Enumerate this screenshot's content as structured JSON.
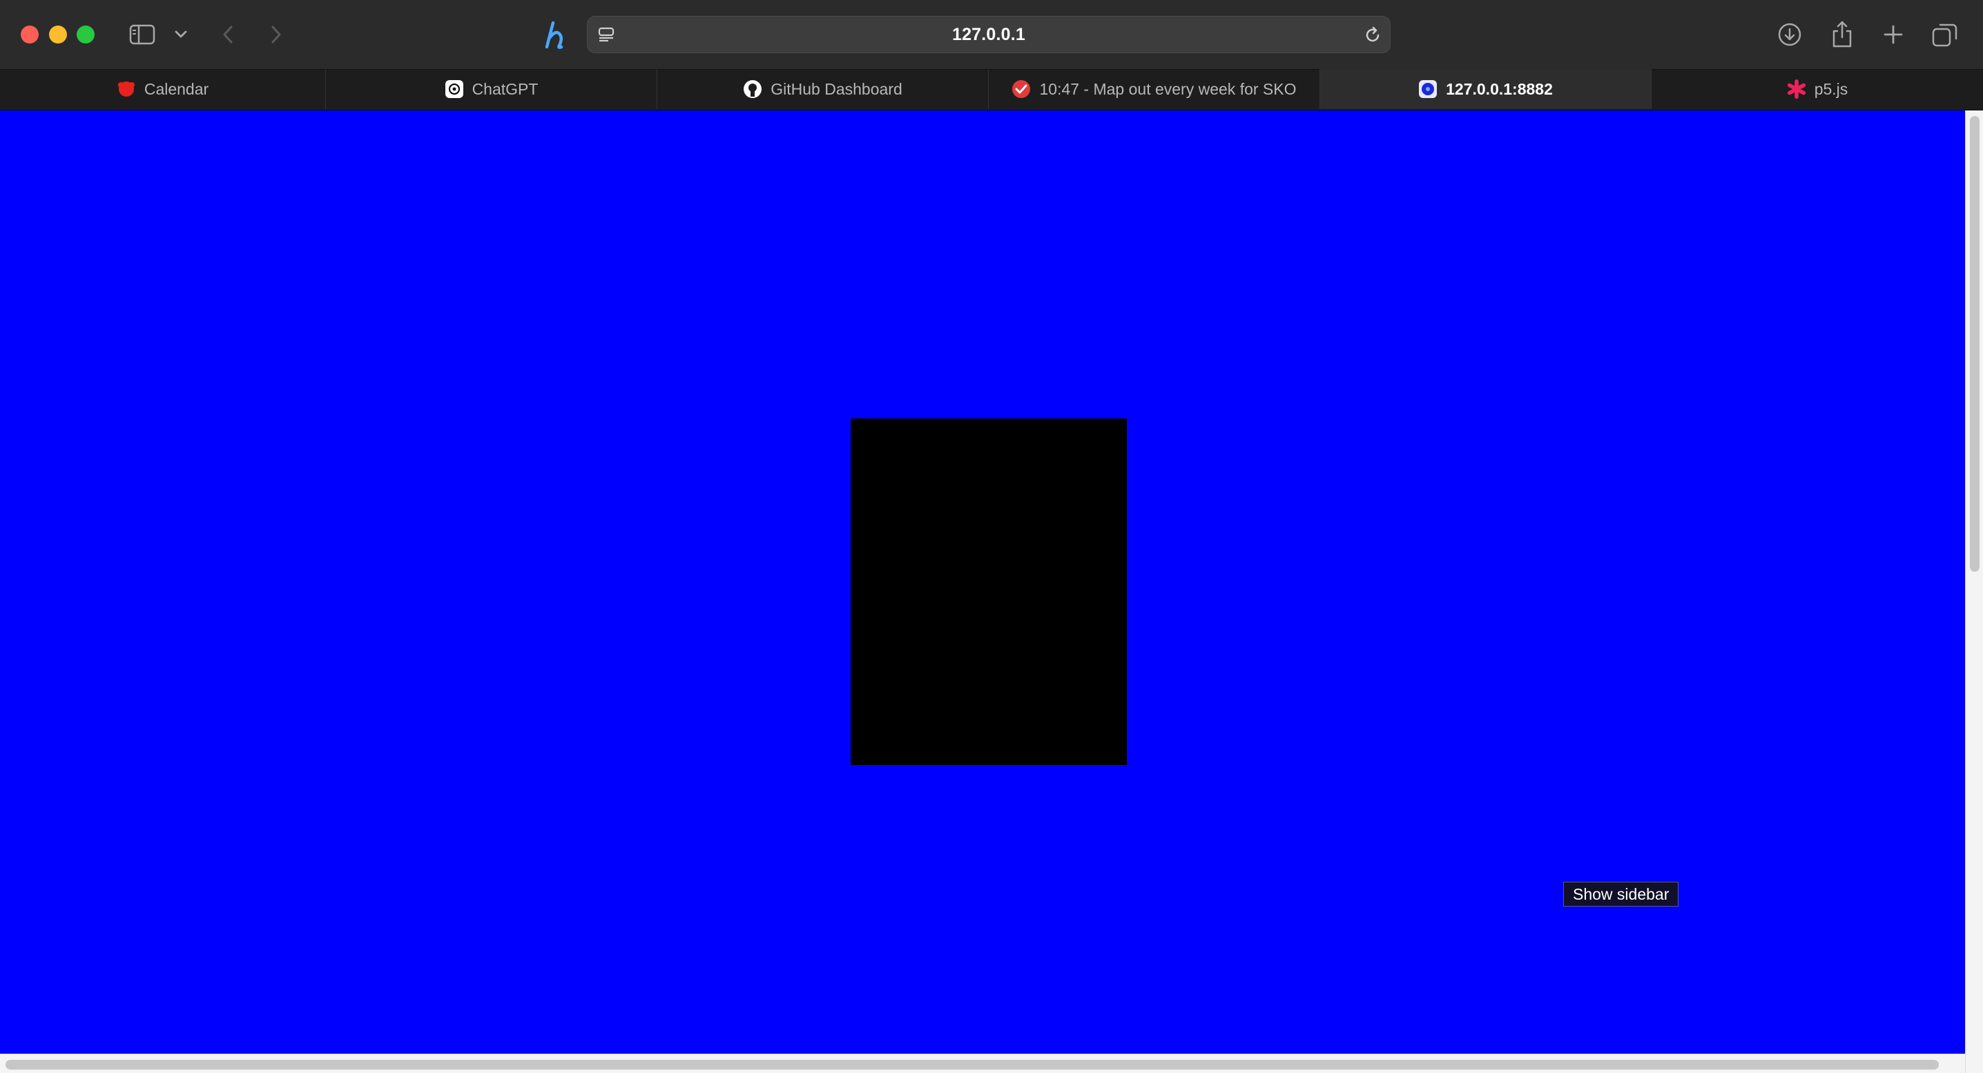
{
  "browser": {
    "address": "127.0.0.1",
    "tabs": [
      {
        "label": "Calendar",
        "icon": "calendar-favicon-icon",
        "active": false
      },
      {
        "label": "ChatGPT",
        "icon": "chatgpt-favicon-icon",
        "active": false
      },
      {
        "label": "GitHub Dashboard",
        "icon": "github-favicon-icon",
        "active": false
      },
      {
        "label": "10:47 - Map out every week for SKO",
        "icon": "checkmark-favicon-icon",
        "active": false,
        "close_glyph": "×"
      },
      {
        "label": "127.0.0.1:8882",
        "icon": "local-server-favicon-icon",
        "active": true
      },
      {
        "label": "p5.js",
        "icon": "p5js-favicon-icon",
        "active": false
      }
    ]
  },
  "page": {
    "background_color": "#0000ff",
    "canvas_fill_color": "#000000",
    "tooltip": "Show sidebar"
  }
}
